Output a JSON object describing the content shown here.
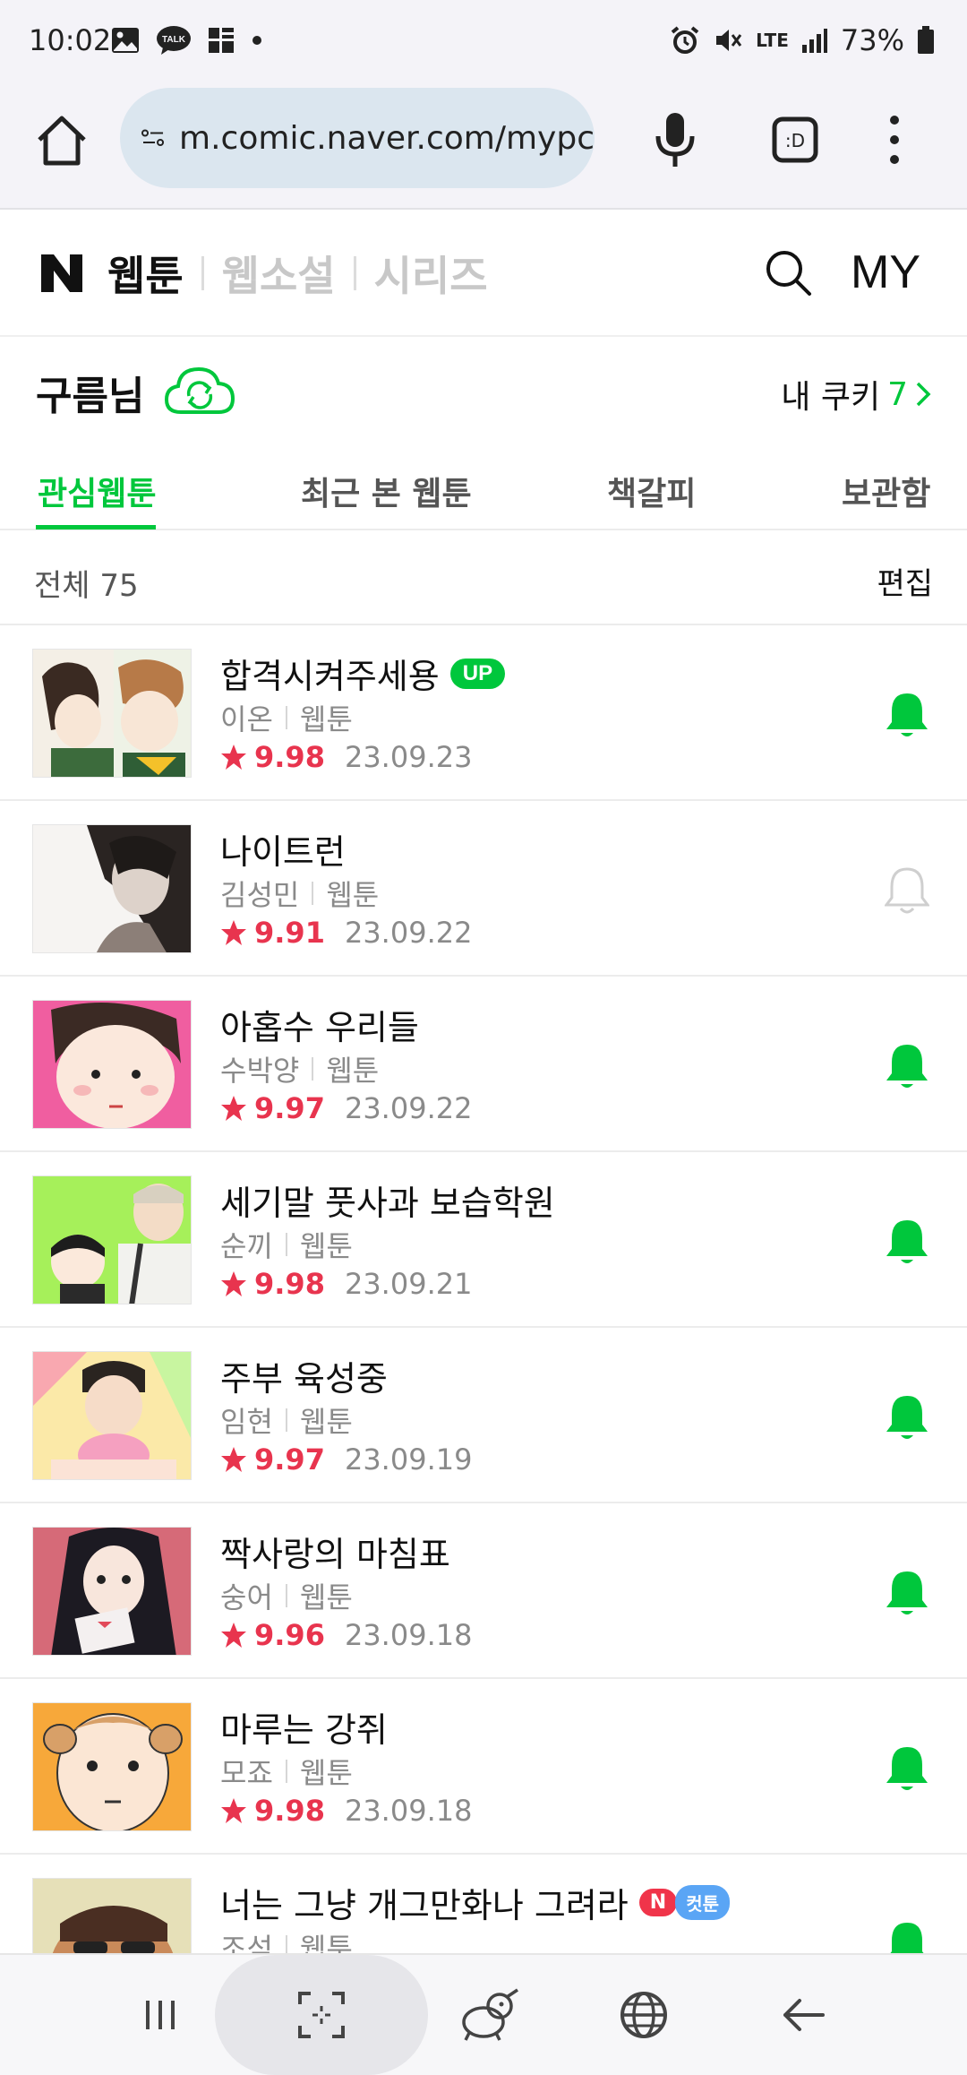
{
  "status_bar": {
    "time": "10:02",
    "network": "LTE",
    "battery": "73%"
  },
  "browser": {
    "url": "m.comic.naver.com/mypc"
  },
  "header": {
    "nav": [
      "웹툰",
      "웹소설",
      "시리즈"
    ],
    "my_label": "MY"
  },
  "user": {
    "name": "구름님",
    "cookie_label": "내 쿠키",
    "cookie_count": "7"
  },
  "tabs": [
    "관심웹툰",
    "최근 본 웹툰",
    "책갈피",
    "보관함"
  ],
  "list_header": {
    "total": "전체 75",
    "edit": "편집"
  },
  "items": [
    {
      "title": "합격시켜주세용",
      "badge": "UP",
      "author": "이온",
      "category": "웹툰",
      "rating": "9.98",
      "date": "23.09.23",
      "notify": true
    },
    {
      "title": "나이트런",
      "author": "김성민",
      "category": "웹툰",
      "rating": "9.91",
      "date": "23.09.22",
      "notify": false
    },
    {
      "title": "아홉수 우리들",
      "author": "수박양",
      "category": "웹툰",
      "rating": "9.97",
      "date": "23.09.22",
      "notify": true
    },
    {
      "title": "세기말 풋사과 보습학원",
      "author": "순끼",
      "category": "웹툰",
      "rating": "9.98",
      "date": "23.09.21",
      "notify": true
    },
    {
      "title": "주부 육성중",
      "author": "임현",
      "category": "웹툰",
      "rating": "9.97",
      "date": "23.09.19",
      "notify": true
    },
    {
      "title": "짝사랑의 마침표",
      "author": "숭어",
      "category": "웹툰",
      "rating": "9.96",
      "date": "23.09.18",
      "notify": true
    },
    {
      "title": "마루는 강쥐",
      "author": "모죠",
      "category": "웹툰",
      "rating": "9.98",
      "date": "23.09.18",
      "notify": true
    },
    {
      "title": "너는 그냥 개그만화나 그려라",
      "badge_n": "N",
      "badge_cut": "컷툰",
      "author": "조석",
      "category": "웹툰",
      "rating": "",
      "date": "",
      "notify": true
    }
  ],
  "colors": {
    "accent": "#00c73c",
    "rating": "#e8344e"
  }
}
